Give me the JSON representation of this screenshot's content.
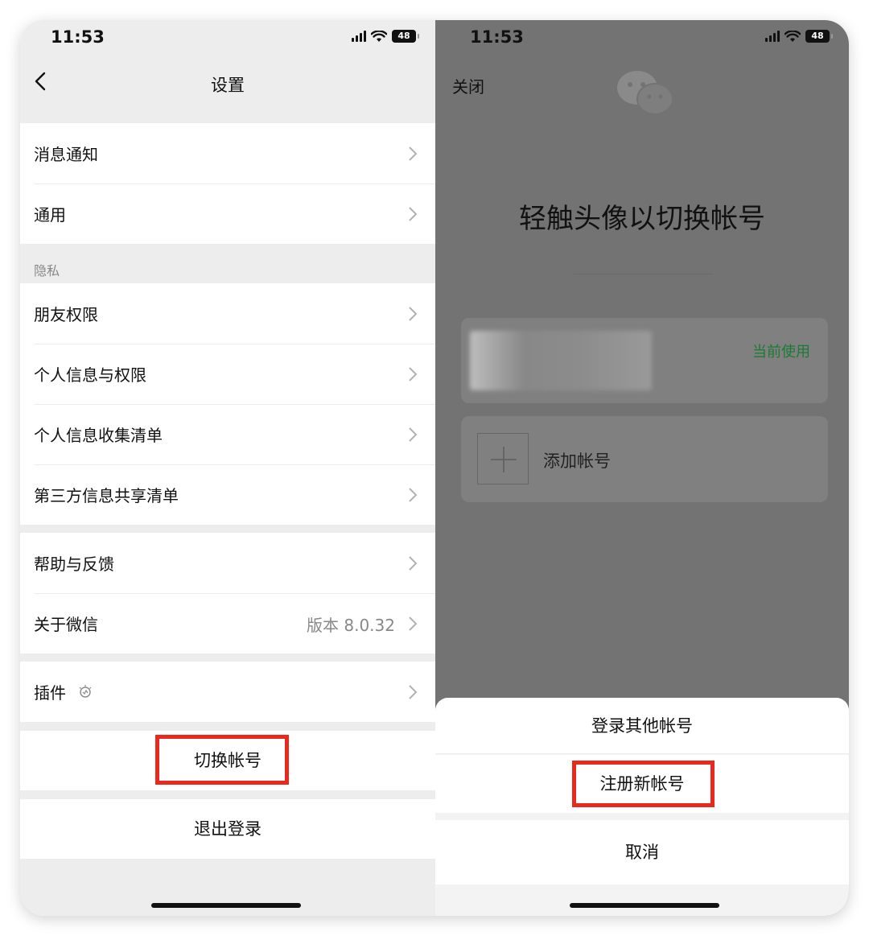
{
  "left": {
    "status": {
      "time": "11:53",
      "battery": "48"
    },
    "nav": {
      "title": "设置"
    },
    "group1": [
      {
        "label": "消息通知"
      },
      {
        "label": "通用"
      }
    ],
    "privacy_section_label": "隐私",
    "group2": [
      {
        "label": "朋友权限"
      },
      {
        "label": "个人信息与权限"
      },
      {
        "label": "个人信息收集清单"
      },
      {
        "label": "第三方信息共享清单"
      }
    ],
    "group3": [
      {
        "label": "帮助与反馈"
      },
      {
        "label": "关于微信",
        "value": "版本 8.0.32"
      }
    ],
    "plugins": {
      "label": "插件",
      "icon": "lightbulb-icon"
    },
    "switch_account": "切换帐号",
    "logout": "退出登录"
  },
  "right": {
    "status": {
      "time": "11:53",
      "battery": "48"
    },
    "close": "关闭",
    "logo_icon": "wechat-logo-icon",
    "title": "轻触头像以切换帐号",
    "current_account_tag": "当前使用",
    "add_account": "添加帐号",
    "sheet": {
      "login_other": "登录其他帐号",
      "register_new": "注册新帐号",
      "cancel": "取消"
    }
  },
  "colors": {
    "highlight_box": "#e8291c",
    "current_tag": "#1c7a33",
    "overlay_bg": "#737373",
    "settings_bg": "#ededed"
  }
}
